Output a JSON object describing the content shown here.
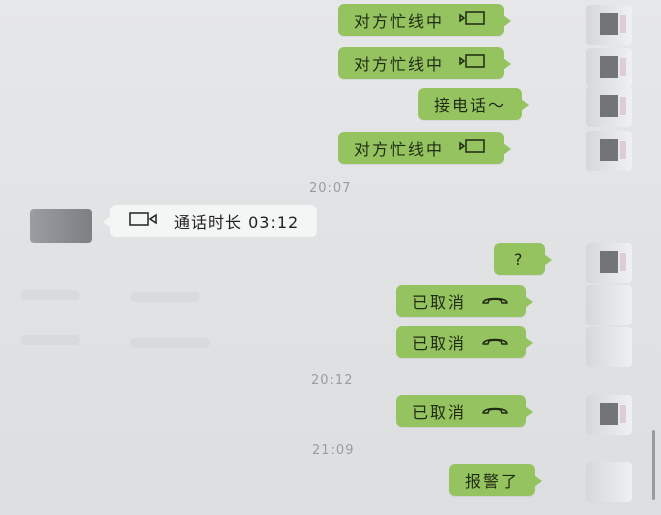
{
  "messages": [
    {
      "id": "m1",
      "text": "对方忙线中",
      "icon": "video-call-icon"
    },
    {
      "id": "m2",
      "text": "对方忙线中",
      "icon": "video-call-icon"
    },
    {
      "id": "m3",
      "text": "接电话～",
      "icon": ""
    },
    {
      "id": "m4",
      "text": "对方忙线中",
      "icon": "video-call-icon"
    },
    {
      "id": "ts1",
      "text": "20:07"
    },
    {
      "id": "m5",
      "text": "通话时长 03:12",
      "icon": "video-call-icon"
    },
    {
      "id": "m6",
      "text": "?",
      "icon": ""
    },
    {
      "id": "m7",
      "text": "已取消",
      "icon": "phone-hangup-icon"
    },
    {
      "id": "m8",
      "text": "已取消",
      "icon": "phone-hangup-icon"
    },
    {
      "id": "ts2",
      "text": "20:12"
    },
    {
      "id": "m9",
      "text": "已取消",
      "icon": "phone-hangup-icon"
    },
    {
      "id": "ts3",
      "text": "21:09"
    },
    {
      "id": "m10",
      "text": "报警了",
      "icon": ""
    }
  ],
  "colors": {
    "outgoing_bubble": "#95c35f",
    "incoming_bubble": "#f4f5f5",
    "background": "#e2e4e6",
    "timestamp": "#9a9c9f"
  }
}
